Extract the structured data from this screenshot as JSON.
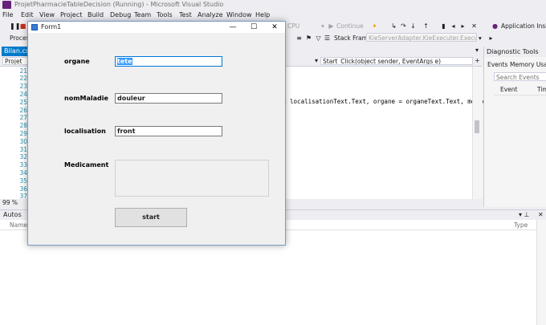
{
  "vs": {
    "title": "ProjetPharmacieTableDecision (Running) - Microsoft Visual Studio",
    "menu": [
      "File",
      "Edit",
      "View",
      "Project",
      "Build",
      "Debug",
      "Team",
      "Tools",
      "Test",
      "Analyze",
      "Window",
      "Help"
    ],
    "toolbar": {
      "process_label": "Proces",
      "cpu": "CPU",
      "continue": "Continue",
      "stack_frame_label": "Stack Frame:",
      "stack_frame_value": "KieServerAdapter.KieExecuter.ExecuteCall",
      "app_insights": "Application Insigh"
    },
    "doc_tab": "Bilan.cs",
    "nav": {
      "project": "Projet",
      "method": "Start_Click(object sender, EventArgs e)"
    },
    "line_numbers": [
      "21",
      "22",
      "23",
      "24",
      "25",
      "26",
      "27",
      "28",
      "29",
      "30",
      "31",
      "32",
      "33",
      "34",
      "35",
      "36",
      "37"
    ],
    "code_visible": "= localisationText.Text, organe = organeText.Text, medic",
    "zoom": "99 %",
    "diagnostic": {
      "title": "Diagnostic Tools",
      "tabs": [
        "Events",
        "Memory Usage"
      ],
      "search_placeholder": "Search Events",
      "col_event": "Event",
      "col_time": "Tim"
    },
    "autos": {
      "title": "Autos",
      "col_name": "Name",
      "col_type": "Type"
    }
  },
  "form1": {
    "title": "Form1",
    "fields": {
      "organe_label": "organe",
      "organe_value": "tete",
      "maladie_label": "nomMaladie",
      "maladie_value": "douleur",
      "localisation_label": "localisation",
      "localisation_value": "front",
      "medicament_label": "Medicament"
    },
    "start_label": "start"
  }
}
